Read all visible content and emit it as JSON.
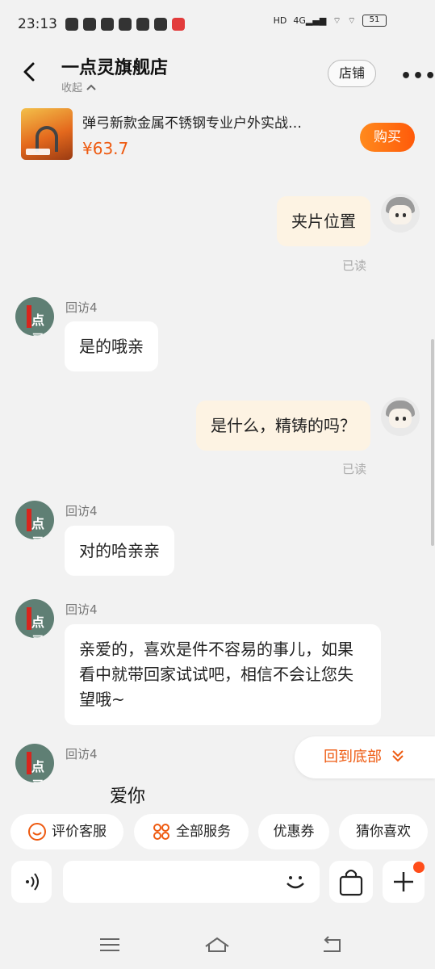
{
  "status_bar": {
    "time": "23:13",
    "battery": "51"
  },
  "header": {
    "shop_name": "一点灵旗舰店",
    "collapse_label": "收起",
    "store_button": "店铺",
    "more": "•••"
  },
  "product": {
    "title": "弹弓新款金属不锈钢专业户外实战…",
    "price": "¥63.7",
    "buy_button": "购买"
  },
  "messages": [
    {
      "from": "me",
      "text": "夹片位置",
      "status": "已读"
    },
    {
      "from": "shop",
      "sender": "回访4",
      "text": "是的哦亲"
    },
    {
      "from": "me",
      "text": "是什么，精铸的吗？",
      "status": "已读"
    },
    {
      "from": "shop",
      "sender": "回访4",
      "text": "对的哈亲亲"
    },
    {
      "from": "shop",
      "sender": "回访4",
      "text": "亲爱的，喜欢是件不容易的事儿，如果看中就带回家试试吧，相信不会让您失望哦~"
    },
    {
      "from": "shop",
      "sender": "回访4",
      "text": "爱你"
    }
  ],
  "back_to_bottom": "回到底部",
  "quick_actions": [
    "评价客服",
    "全部服务",
    "优惠券",
    "猜你喜欢"
  ],
  "input": {
    "placeholder": ""
  },
  "colors": {
    "accent": "#ee5a10",
    "me_bubble": "#fdf3e3",
    "shop_avatar": "#5f7f74"
  }
}
